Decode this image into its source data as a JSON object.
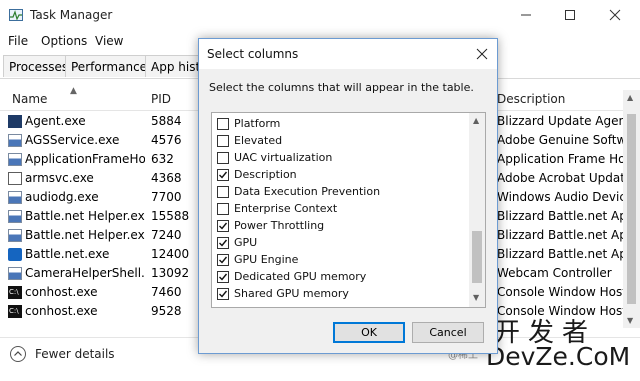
{
  "window": {
    "title": "Task Manager",
    "menu": [
      "File",
      "Options",
      "View"
    ],
    "tabs": [
      "Processes",
      "Performance",
      "App history"
    ],
    "columns": {
      "name": "Name",
      "pid": "PID",
      "description": "Description"
    },
    "processes": [
      {
        "name": "Agent.exe",
        "pid": "5884",
        "description": "Blizzard Update Agent",
        "icon": "blizzard-icon"
      },
      {
        "name": "AGSService.exe",
        "pid": "4576",
        "description": "Adobe Genuine Software",
        "icon": "service-icon"
      },
      {
        "name": "ApplicationFrameHo...",
        "pid": "632",
        "description": "Application Frame Host",
        "icon": "service-icon"
      },
      {
        "name": "armsvc.exe",
        "pid": "4368",
        "description": "Adobe Acrobat Update S",
        "icon": "window-icon"
      },
      {
        "name": "audiodg.exe",
        "pid": "7700",
        "description": "Windows Audio Device G",
        "icon": "service-icon"
      },
      {
        "name": "Battle.net Helper.exe",
        "pid": "15588",
        "description": "Blizzard Battle.net App B",
        "icon": "service-icon"
      },
      {
        "name": "Battle.net Helper.exe",
        "pid": "7240",
        "description": "Blizzard Battle.net App B",
        "icon": "service-icon"
      },
      {
        "name": "Battle.net.exe",
        "pid": "12400",
        "description": "Blizzard Battle.net App",
        "icon": "battlenet-icon"
      },
      {
        "name": "CameraHelperShell.e",
        "pid": "13092",
        "description": "Webcam Controller",
        "icon": "service-icon"
      },
      {
        "name": "conhost.exe",
        "pid": "7460",
        "description": "Console Window Host",
        "icon": "console-icon"
      },
      {
        "name": "conhost.exe",
        "pid": "9528",
        "description": "Console Window Host",
        "icon": "console-icon"
      }
    ],
    "footer": {
      "label": "Fewer details"
    }
  },
  "dialog": {
    "title": "Select columns",
    "instruction": "Select the columns that will appear in the table.",
    "items": [
      {
        "label": "Platform",
        "checked": false
      },
      {
        "label": "Elevated",
        "checked": false
      },
      {
        "label": "UAC virtualization",
        "checked": false
      },
      {
        "label": "Description",
        "checked": true
      },
      {
        "label": "Data Execution Prevention",
        "checked": false
      },
      {
        "label": "Enterprise Context",
        "checked": false
      },
      {
        "label": "Power Throttling",
        "checked": true
      },
      {
        "label": "GPU",
        "checked": true
      },
      {
        "label": "GPU Engine",
        "checked": true
      },
      {
        "label": "Dedicated GPU memory",
        "checked": true
      },
      {
        "label": "Shared GPU memory",
        "checked": true
      }
    ],
    "ok_label": "OK",
    "cancel_label": "Cancel"
  },
  "watermark": {
    "cn": "开发者",
    "en": "DevZe.CoM",
    "small": "@稀土"
  },
  "colors": {
    "accent": "#0078d7",
    "dialog_border": "#6c9bd2"
  }
}
